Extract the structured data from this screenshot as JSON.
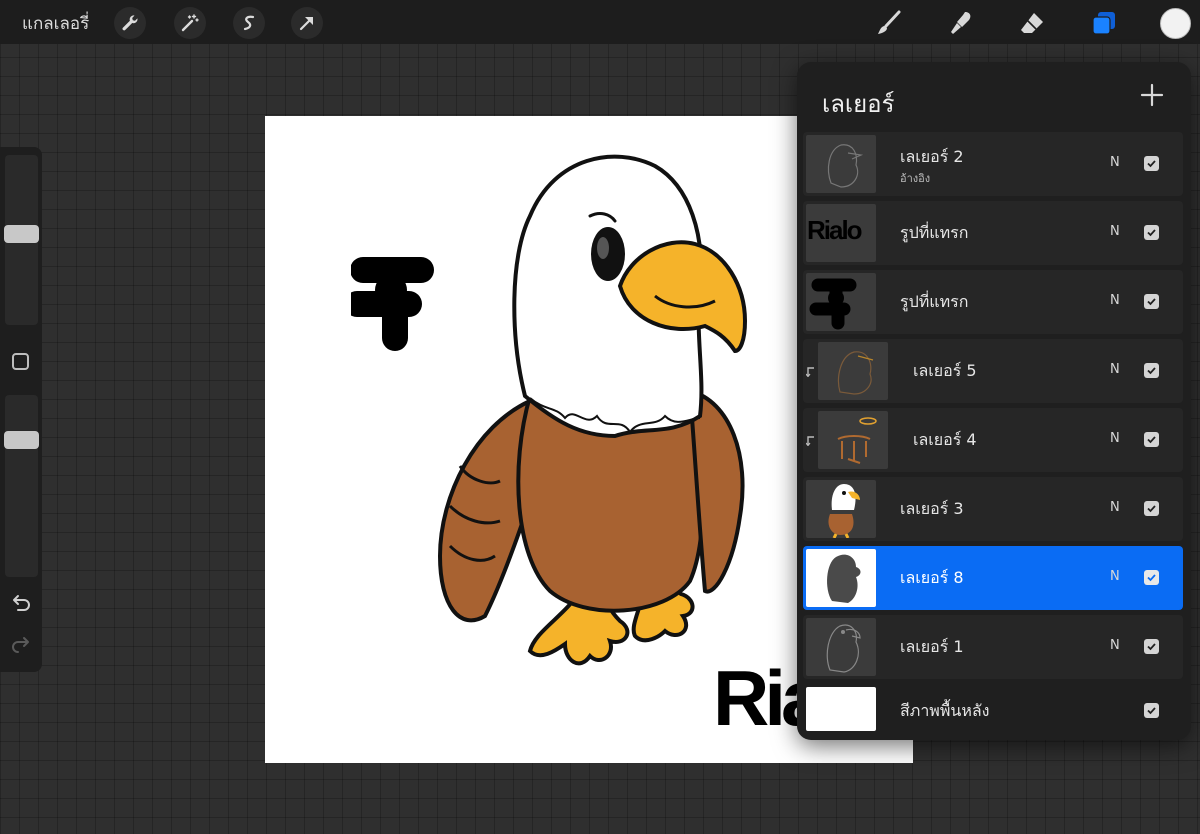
{
  "topbar": {
    "gallery_label": "แกลเลอรี่",
    "left_tools": [
      "wrench-icon",
      "magic-wand-icon",
      "selection-icon",
      "transform-arrow-icon"
    ],
    "right_tools": [
      "brush-icon",
      "smudge-icon",
      "eraser-icon",
      "layers-icon"
    ],
    "active_tool_color": "#1a82ff",
    "current_color": "#f2f2f2"
  },
  "sidebar": {
    "brush_size": 0.54,
    "opacity": 0.78,
    "modify_button": "square-modify-icon",
    "undo": "undo-icon",
    "redo": "redo-icon"
  },
  "canvas": {
    "text": "Rialo"
  },
  "layers_panel": {
    "title": "เลเยอร์",
    "add_button": "plus-icon",
    "layers": [
      {
        "name": "เลเยอร์ 2",
        "sub": "อ้างอิง",
        "mode": "N",
        "visible": true,
        "active": false,
        "clipped": false
      },
      {
        "name": "รูปที่แทรก",
        "mode": "N",
        "visible": true,
        "active": false,
        "clipped": false,
        "thumb_text": "Rialo"
      },
      {
        "name": "รูปที่แทรก",
        "mode": "N",
        "visible": true,
        "active": false,
        "clipped": false
      },
      {
        "name": "เลเยอร์ 5",
        "mode": "N",
        "visible": true,
        "active": false,
        "clipped": true
      },
      {
        "name": "เลเยอร์ 4",
        "mode": "N",
        "visible": true,
        "active": false,
        "clipped": true
      },
      {
        "name": "เลเยอร์ 3",
        "mode": "N",
        "visible": true,
        "active": false,
        "clipped": false
      },
      {
        "name": "เลเยอร์ 8",
        "mode": "N",
        "visible": true,
        "active": true,
        "clipped": false
      },
      {
        "name": "เลเยอร์ 1",
        "mode": "N",
        "visible": true,
        "active": false,
        "clipped": false
      },
      {
        "name": "สีภาพพื้นหลัง",
        "visible": true,
        "active": false,
        "clipped": false
      }
    ]
  }
}
